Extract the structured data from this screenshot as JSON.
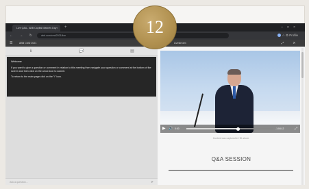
{
  "badge": {
    "number": "12"
  },
  "browser": {
    "tab_title": "Live Q&A - ABB Capital Markets Day",
    "address": "abb.com/cmd2021/live",
    "nav_icons": "← → ↻ ⌂",
    "extensions": "☆ ⚙ Profile"
  },
  "app": {
    "title": "ABB CMD 2021",
    "right_title": "Livestream",
    "right_icons": "⤢ ✕"
  },
  "left_tabs": [
    {
      "label": "ℹ"
    },
    {
      "label": "💬"
    },
    {
      "label": "▤"
    }
  ],
  "chat": {
    "heading": "Welcome",
    "message1": "If you want to give a question or comment in relation to this meeting then navigate your question or comment at the bottom of the screen and then click on the arrow icon to submit.",
    "message2": "To return to the main page click on the \"i\" icon."
  },
  "left_footer": {
    "input_placeholder": "Ask a question...",
    "send_icon": "➤"
  },
  "video": {
    "current_time": "0:00",
    "remaining_time": "-1:04:12",
    "progress": 0.6,
    "caption": "Content was captured in HD above.",
    "play_icon": "▶",
    "volume_icon": "🔊",
    "fullscreen_icon": "⤢"
  },
  "session": {
    "label": "Q&A SESSION"
  }
}
